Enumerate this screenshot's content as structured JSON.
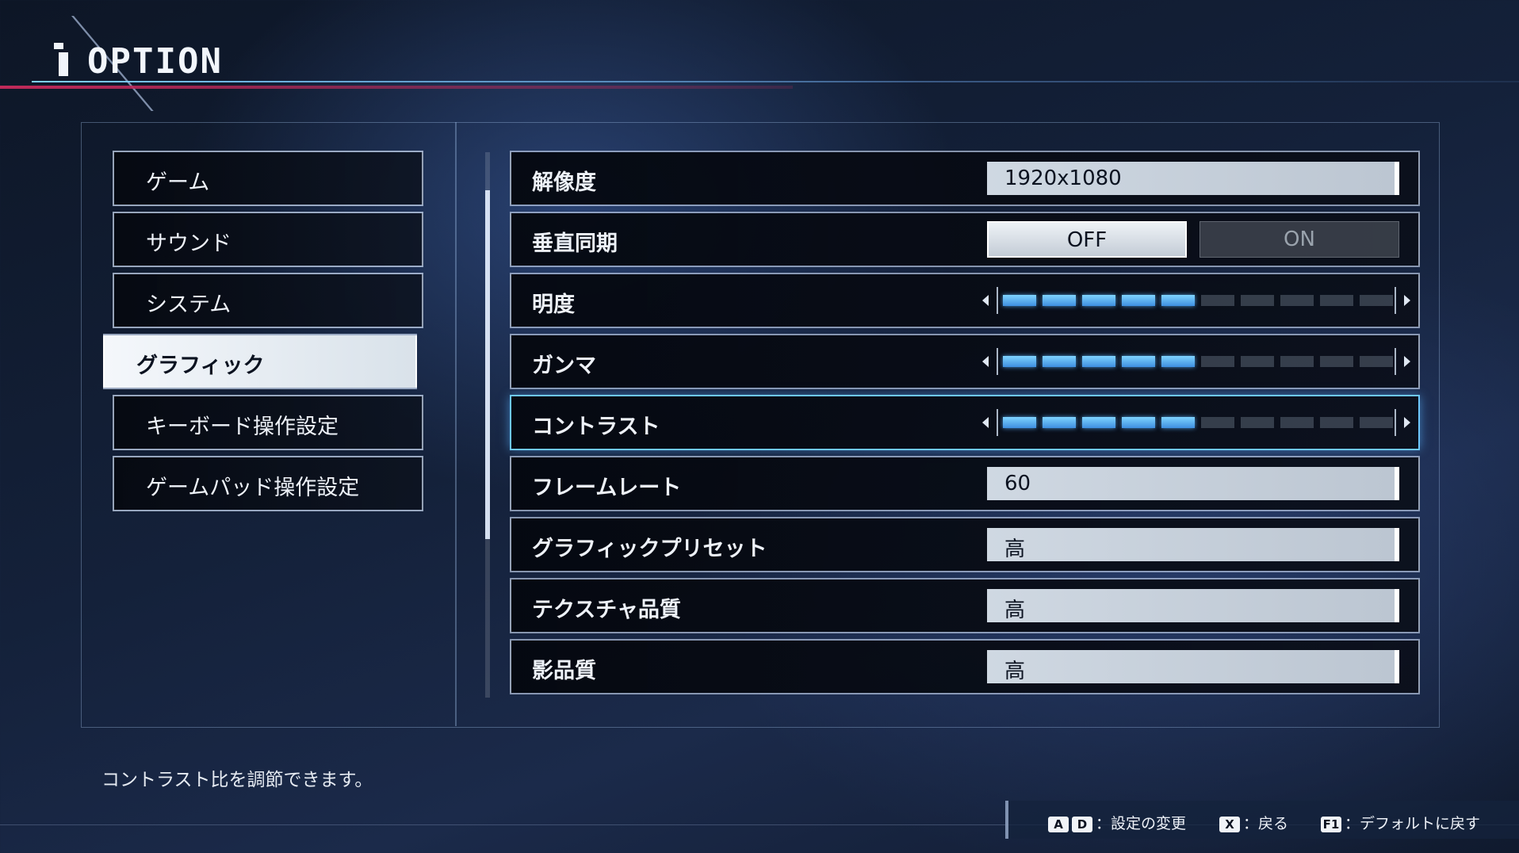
{
  "header": {
    "title": "OPTION"
  },
  "menu": {
    "items": [
      {
        "label": "ゲーム",
        "selected": false
      },
      {
        "label": "サウンド",
        "selected": false
      },
      {
        "label": "システム",
        "selected": false
      },
      {
        "label": "グラフィック",
        "selected": true
      },
      {
        "label": "キーボード操作設定",
        "selected": false
      },
      {
        "label": "ゲームパッド操作設定",
        "selected": false
      }
    ]
  },
  "settings": {
    "resolution": {
      "label": "解像度",
      "value": "1920x1080"
    },
    "vsync": {
      "label": "垂直同期",
      "off_label": "OFF",
      "on_label": "ON",
      "selected": "OFF"
    },
    "brightness": {
      "label": "明度",
      "level": 5,
      "max": 10
    },
    "gamma": {
      "label": "ガンマ",
      "level": 5,
      "max": 10
    },
    "contrast": {
      "label": "コントラスト",
      "level": 5,
      "max": 10,
      "focused": true
    },
    "framerate": {
      "label": "フレームレート",
      "value": "60"
    },
    "preset": {
      "label": "グラフィックプリセット",
      "value": "高"
    },
    "texture": {
      "label": "テクスチャ品質",
      "value": "高"
    },
    "shadow": {
      "label": "影品質",
      "value": "高"
    }
  },
  "description": "コントラスト比を調節できます。",
  "hints": {
    "change": {
      "keys": [
        "A",
        "D"
      ],
      "label": "：設定の変更"
    },
    "back": {
      "keys": [
        "X"
      ],
      "label": "：戻る"
    },
    "default": {
      "keys": [
        "F1"
      ],
      "label": "：デフォルトに戻す"
    }
  },
  "colors": {
    "accent": "#6ec8ff",
    "slider_lit": "#5ab0f0",
    "highlight_pink": "#c02a5a"
  }
}
